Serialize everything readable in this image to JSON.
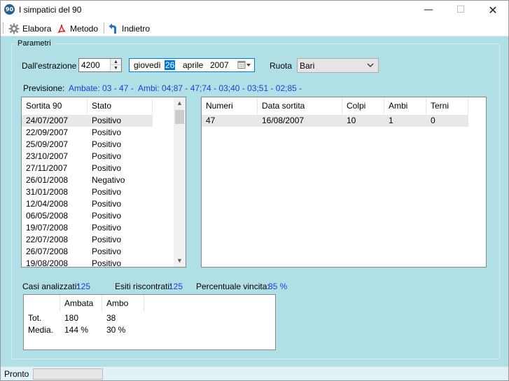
{
  "window": {
    "title": "I simpatici del 90",
    "icon_text": "90"
  },
  "toolbar": {
    "elabora_label": "Elabora",
    "metodo_label": "Metodo",
    "indietro_label": "Indietro"
  },
  "params": {
    "group_label": "Parametri",
    "estrazione_label": "Dall'estrazione",
    "estrazione_value": "4200",
    "date": {
      "weekday": "giovedì",
      "day": "26",
      "month": "aprile",
      "year": "2007"
    },
    "ruota_label": "Ruota",
    "ruota_value": "Bari"
  },
  "previsione": {
    "label": "Previsione:",
    "ambate": "Ambate: 03 -  47 -",
    "ambi": "Ambi: 04;87 -  47;74 -  03;40 -  03;51 -  02;85 -"
  },
  "sortite_list": {
    "headers": [
      "Sortita 90",
      "Stato"
    ],
    "rows": [
      [
        "24/07/2007",
        "Positivo"
      ],
      [
        "22/09/2007",
        "Positivo"
      ],
      [
        "25/09/2007",
        "Positivo"
      ],
      [
        "23/10/2007",
        "Positivo"
      ],
      [
        "27/11/2007",
        "Positivo"
      ],
      [
        "26/01/2008",
        "Negativo"
      ],
      [
        "31/01/2008",
        "Positivo"
      ],
      [
        "12/04/2008",
        "Positivo"
      ],
      [
        "06/05/2008",
        "Positivo"
      ],
      [
        "19/07/2008",
        "Positivo"
      ],
      [
        "22/07/2008",
        "Positivo"
      ],
      [
        "26/07/2008",
        "Positivo"
      ],
      [
        "19/08/2008",
        "Positivo"
      ]
    ]
  },
  "dettaglio_list": {
    "headers": [
      "Numeri",
      "Data sortita",
      "Colpi",
      "Ambi",
      "Terni"
    ],
    "rows": [
      [
        "47",
        "16/08/2007",
        "10",
        "1",
        "0"
      ]
    ]
  },
  "stats": {
    "casi_label": "Casi analizzati:",
    "casi_value": "125",
    "esiti_label": "Esiti riscontrati:",
    "esiti_value": "125",
    "percentuale_label": "Percentuale vincita:",
    "percentuale_value": "85 %"
  },
  "summary_table": {
    "headers": [
      "",
      "Ambata",
      "Ambo"
    ],
    "rows": [
      [
        "Tot.",
        "180",
        "38"
      ],
      [
        "Media.",
        "144 %",
        "30 %"
      ]
    ]
  },
  "status": {
    "text": "Pronto"
  },
  "colors": {
    "background": "#b0e0e6",
    "accent_text": "#1c3fd8",
    "selection": "#0078d7"
  }
}
